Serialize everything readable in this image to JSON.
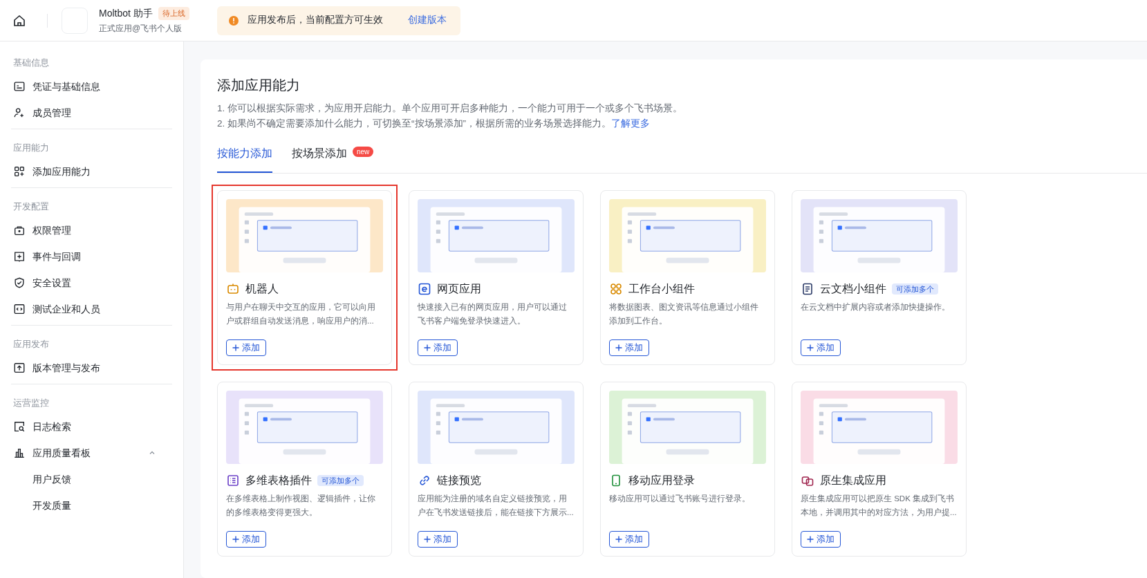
{
  "header": {
    "app_name": "Moltbot 助手",
    "status_badge": "待上线",
    "app_subtitle": "正式应用@飞书个人版",
    "notice": "应用发布后，当前配置方可生效",
    "notice_link": "创建版本"
  },
  "sidebar": {
    "sections": [
      {
        "title": "基础信息",
        "items": [
          {
            "label": "凭证与基础信息"
          },
          {
            "label": "成员管理"
          }
        ]
      },
      {
        "title": "应用能力",
        "items": [
          {
            "label": "添加应用能力"
          }
        ]
      },
      {
        "title": "开发配置",
        "items": [
          {
            "label": "权限管理"
          },
          {
            "label": "事件与回调"
          },
          {
            "label": "安全设置"
          },
          {
            "label": "测试企业和人员"
          }
        ]
      },
      {
        "title": "应用发布",
        "items": [
          {
            "label": "版本管理与发布"
          }
        ]
      },
      {
        "title": "运营监控",
        "items": [
          {
            "label": "日志检索"
          },
          {
            "label": "应用质量看板",
            "expanded": true,
            "children": [
              {
                "label": "用户反馈"
              },
              {
                "label": "开发质量"
              }
            ]
          }
        ]
      }
    ]
  },
  "main": {
    "title": "添加应用能力",
    "notes": [
      "1. 你可以根据实际需求，为应用开启能力。单个应用可开启多种能力，一个能力可用于一个或多个飞书场景。",
      "2. 如果尚不确定需要添加什么能力，可切换至“按场景添加”，根据所需的业务场景选择能力。"
    ],
    "learn_more": "了解更多",
    "tabs": [
      {
        "label": "按能力添加",
        "selected": true
      },
      {
        "label": "按场景添加",
        "selected": false,
        "badge": "new"
      }
    ],
    "cards": [
      {
        "title": "机器人",
        "color": "#fde7c8",
        "highlighted": true,
        "description": "与用户在聊天中交互的应用，它可以向用户或群组自动发送消息，响应用户的消...",
        "button": "添加"
      },
      {
        "title": "网页应用",
        "color": "#dfe6fb",
        "highlighted": false,
        "description": "快速接入已有的网页应用，用户可以通过飞书客户端免登录快速进入。",
        "button": "添加"
      },
      {
        "title": "工作台小组件",
        "color": "#f9f0c4",
        "highlighted": false,
        "description": "将数据图表、图文资讯等信息通过小组件添加到工作台。",
        "button": "添加"
      },
      {
        "title": "云文档小组件",
        "color": "#e3e3f8",
        "highlighted": false,
        "badge": "可添加多个",
        "description": "在云文档中扩展内容或者添加快捷操作。",
        "button": "添加"
      },
      {
        "title": "多维表格插件",
        "color": "#e8e2fa",
        "highlighted": false,
        "badge": "可添加多个",
        "description": "在多维表格上制作视图、逻辑插件，让你的多维表格变得更强大。",
        "button": "添加"
      },
      {
        "title": "链接预览",
        "color": "#dfe6fb",
        "highlighted": false,
        "description": "应用能为注册的域名自定义链接预览，用户在飞书发送链接后，能在链接下方展示...",
        "button": "添加"
      },
      {
        "title": "移动应用登录",
        "color": "#dcf2d6",
        "highlighted": false,
        "description": "移动应用可以通过飞书账号进行登录。",
        "button": "添加"
      },
      {
        "title": "原生集成应用",
        "color": "#fadce6",
        "highlighted": false,
        "description": "原生集成应用可以把原生 SDK 集成到飞书本地，并调用其中的对应方法，为用户提...",
        "button": "添加"
      }
    ]
  }
}
